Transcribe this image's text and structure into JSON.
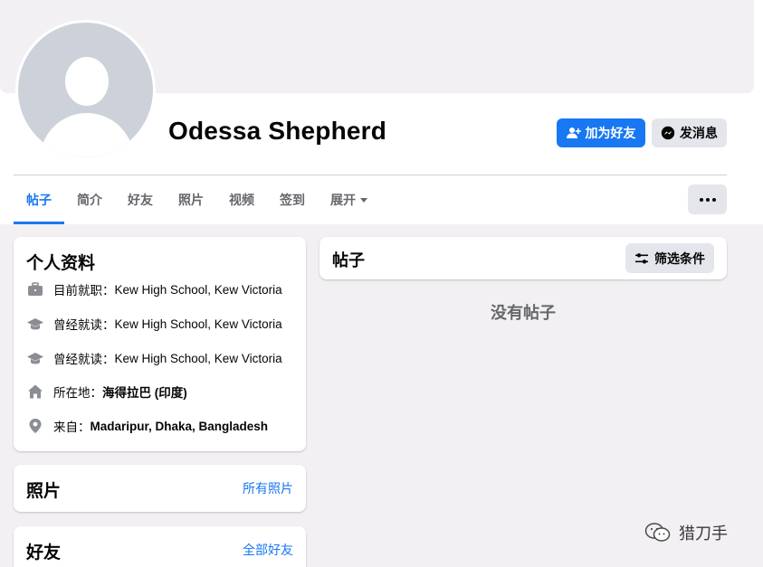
{
  "profile": {
    "name": "Odessa Shepherd"
  },
  "actions": {
    "add_friend_label": "加为好友",
    "message_label": "发消息"
  },
  "tabs": [
    {
      "label": "帖子",
      "active": true
    },
    {
      "label": "简介"
    },
    {
      "label": "好友"
    },
    {
      "label": "照片"
    },
    {
      "label": "视频"
    },
    {
      "label": "签到"
    },
    {
      "label": "展开"
    }
  ],
  "intro": {
    "title": "个人资料",
    "rows": [
      {
        "icon": "briefcase-icon",
        "prefix": "目前就职：",
        "value": "Kew High School, Kew Victoria"
      },
      {
        "icon": "graduation-cap-icon",
        "prefix": "曾经就读：",
        "value": "Kew High School, Kew Victoria"
      },
      {
        "icon": "graduation-cap-icon",
        "prefix": "曾经就读：",
        "value": "Kew High School, Kew Victoria"
      },
      {
        "icon": "home-icon",
        "prefix": "所在地：",
        "value": "海得拉巴 (印度)"
      },
      {
        "icon": "location-pin-icon",
        "prefix": "来自：",
        "value": "Madaripur, Dhaka, Bangladesh"
      }
    ]
  },
  "photos": {
    "title": "照片",
    "link": "所有照片"
  },
  "friends": {
    "title": "好友",
    "link": "全部好友"
  },
  "posts": {
    "title": "帖子",
    "filter_label": "筛选条件",
    "empty_text": "没有帖子"
  },
  "watermark": {
    "text": "猎刀手"
  },
  "colors": {
    "accent": "#1877f2",
    "background": "#f2f0f3",
    "muted_text": "#65676b",
    "button_gray": "#e4e6eb"
  }
}
